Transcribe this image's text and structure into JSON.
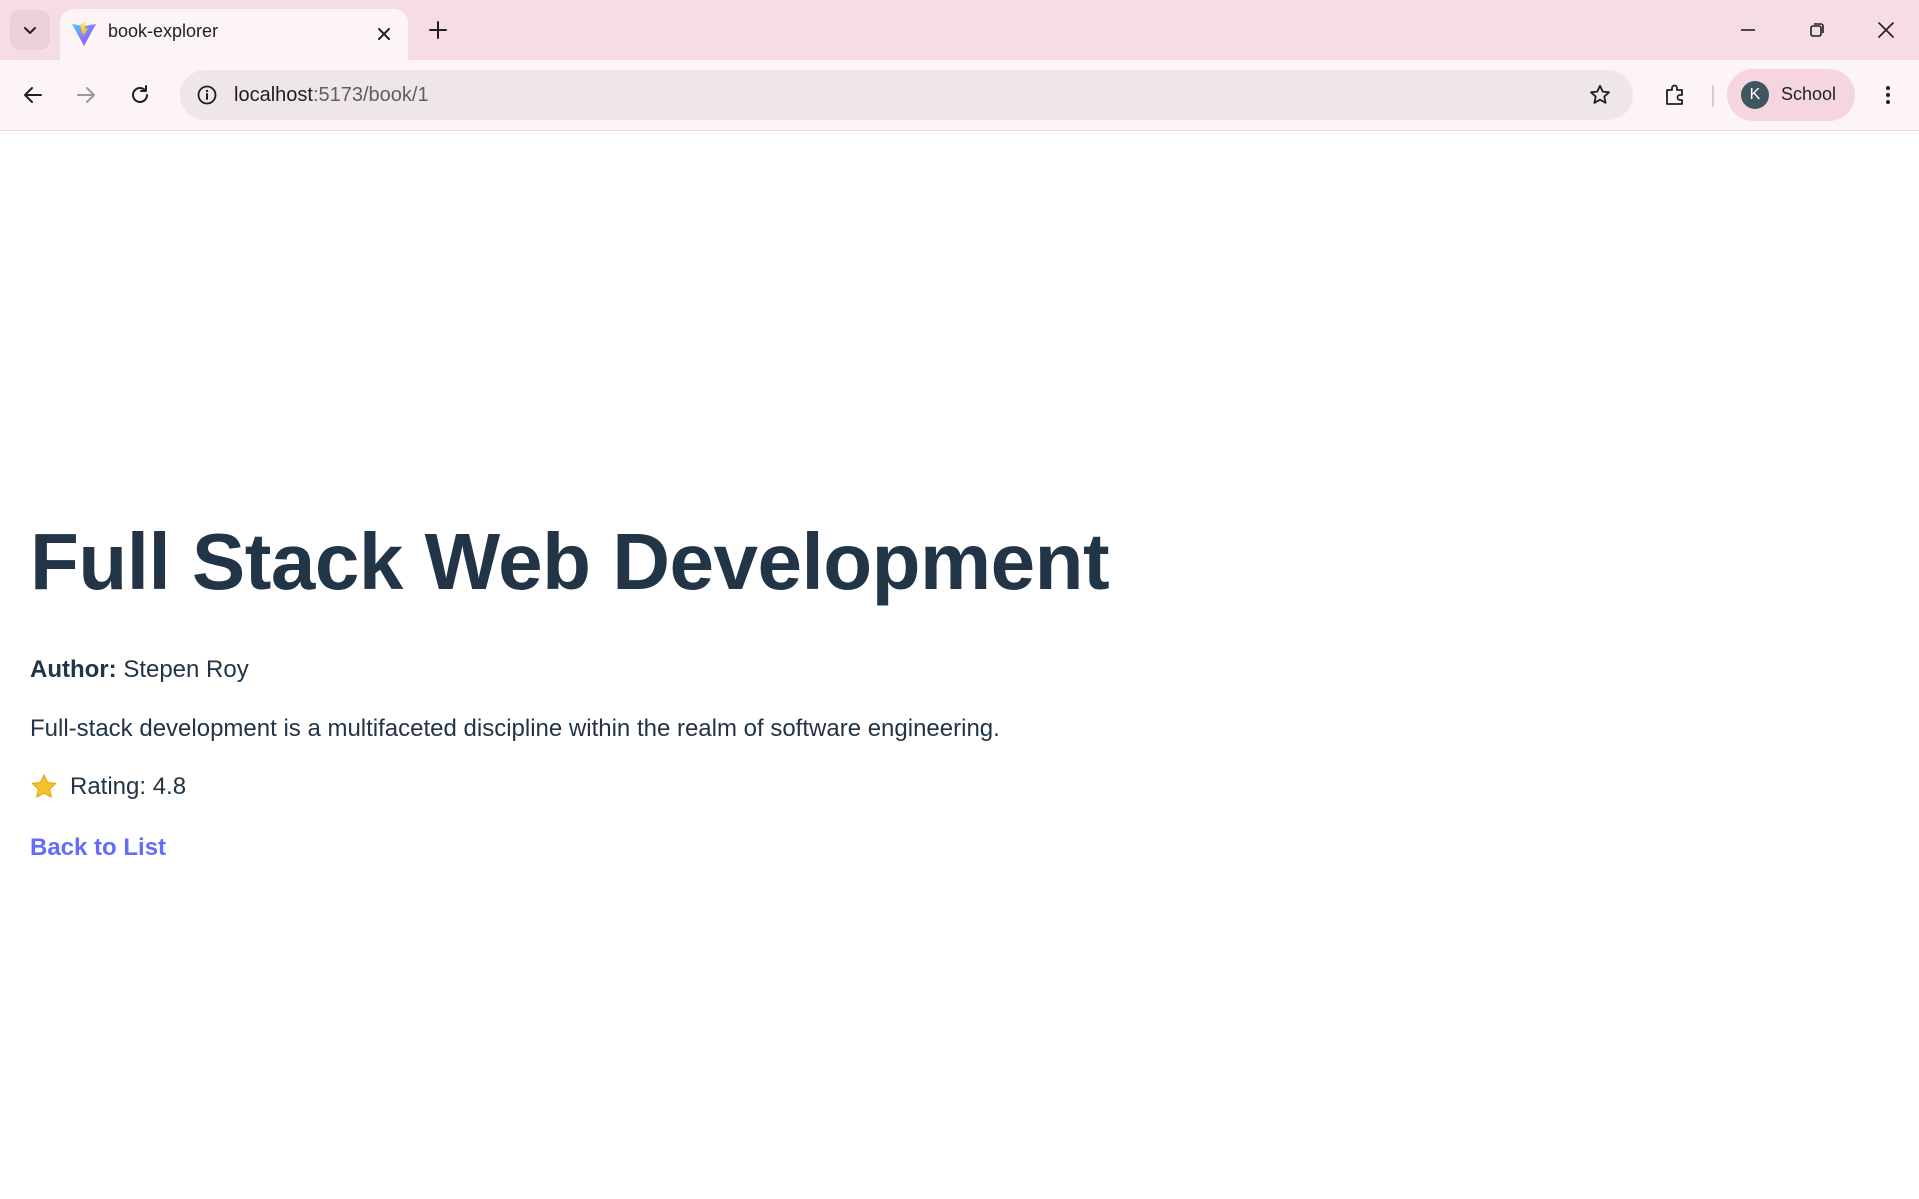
{
  "browser": {
    "tab": {
      "title": "book-explorer"
    },
    "address_bar": {
      "host": "localhost",
      "path": ":5173/book/1"
    },
    "profile": {
      "initial": "K",
      "label": "School"
    }
  },
  "page": {
    "title": "Full Stack Web Development",
    "author_label": "Author:",
    "author_name": "Stepen Roy",
    "description": "Full-stack development is a multifaceted discipline within the realm of software engineering.",
    "rating_text": "Rating: 4.8",
    "back_link": "Back to List"
  },
  "colors": {
    "heading": "#213547",
    "link": "#646cff",
    "tabstrip": "#f5dde3",
    "toolbar": "#fdf4f5"
  }
}
